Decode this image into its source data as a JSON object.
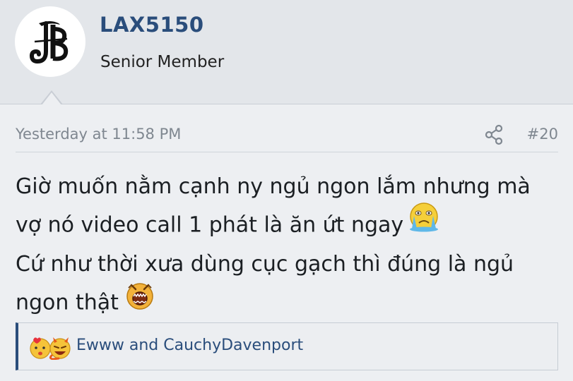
{
  "user": {
    "name": "LAX5150",
    "title": "Senior Member",
    "avatar_icon": "jb-monogram-logo"
  },
  "post": {
    "timestamp": "Yesterday at 11:58 PM",
    "number": "#20",
    "share_icon": "share-icon",
    "lines": [
      "Giờ muốn nằm cạnh ny ngủ ngon lắm nhưng mà",
      "vợ nó video call 1 phát là ăn ứt ngay",
      "Cứ như thời xưa dùng cục gạch thì đúng là ngủ",
      "ngon thật"
    ],
    "emojis": [
      "crying-emoji",
      "shouting-emoji"
    ]
  },
  "reactions": {
    "text": "Ewww and CauchyDavenport",
    "icons": [
      "love-kiss-icon",
      "haha-icon"
    ]
  },
  "colors": {
    "accent": "#2a4d7b",
    "background": "#e3e6ea",
    "post_background": "#edeff2",
    "muted_text": "#7f8790"
  }
}
